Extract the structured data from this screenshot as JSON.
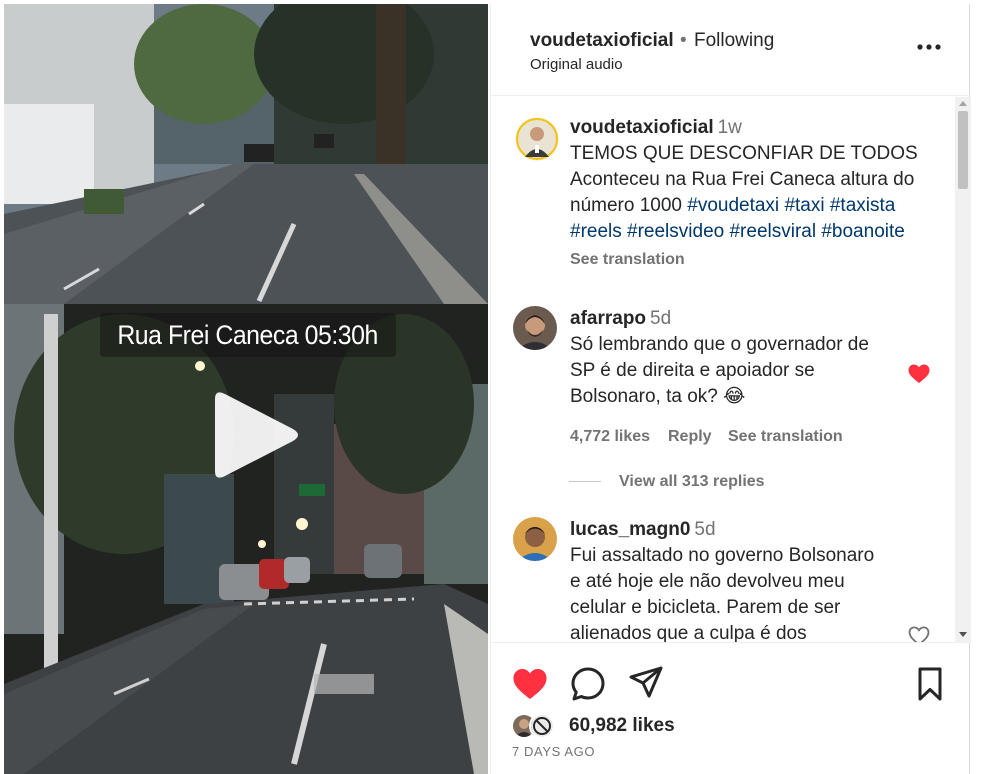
{
  "video": {
    "caption": "Rua Frei Caneca 05:30h",
    "play_icon": "play-icon"
  },
  "header": {
    "username": "voudetaxioficial",
    "separator": "•",
    "follow_status": "Following",
    "audio_label": "Original audio",
    "more_icon": "more-options-icon"
  },
  "post": {
    "author": "voudetaxioficial",
    "time": "1w",
    "lines": [
      "TEMOS QUE DESCONFIAR DE TODOS",
      "Aconteceu na Rua Frei Caneca altura do"
    ],
    "line3_text": "número 1000",
    "hashtags_line3": [
      "#voudetaxi",
      "#taxi",
      "#taxista"
    ],
    "hashtags_line4": [
      "#reels",
      "#reelsvideo",
      "#reelsviral",
      "#boanoite"
    ],
    "see_translation": "See translation"
  },
  "comments": [
    {
      "user": "afarrapo",
      "time": "5d",
      "lines": [
        "Só lembrando que o governador de",
        "SP é de direita e apoiador se",
        "Bolsonaro, ta ok? 😂"
      ],
      "likes": "4,772 likes",
      "reply": "Reply",
      "see_translation": "See translation",
      "liked": true,
      "view_replies": "View all 313 replies"
    },
    {
      "user": "lucas_magn0",
      "time": "5d",
      "lines": [
        "Fui assaltado no governo Bolsonaro",
        "e até hoje ele não devolveu meu",
        "celular e bicicleta. Parem de ser",
        "alienados que a culpa é dos"
      ],
      "liked": false
    }
  ],
  "actions": {
    "likes": "60,982 likes",
    "date": "7 DAYS AGO",
    "liked": true
  },
  "colors": {
    "like_red": "#ff3040",
    "text": "#262626",
    "secondary": "#737373",
    "hashtag": "#00376b"
  }
}
